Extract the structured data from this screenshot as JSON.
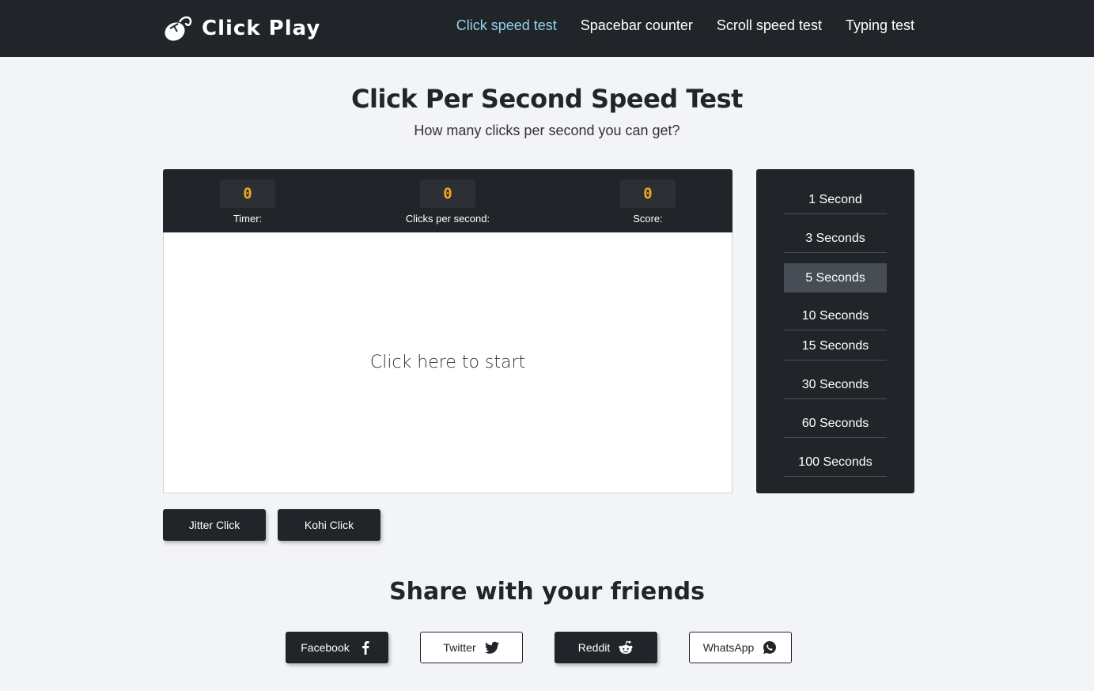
{
  "header": {
    "brand": "Click Play",
    "nav": [
      {
        "label": "Click speed test",
        "active": true
      },
      {
        "label": "Spacebar counter",
        "active": false
      },
      {
        "label": "Scroll speed test",
        "active": false
      },
      {
        "label": "Typing test",
        "active": false
      }
    ]
  },
  "main": {
    "title": "Click Per Second Speed Test",
    "subtitle": "How many clicks per second you can get?"
  },
  "stats": {
    "timer": {
      "value": "0",
      "label": "Timer:"
    },
    "cps": {
      "value": "0",
      "label": "Clicks per second:"
    },
    "score": {
      "value": "0",
      "label": "Score:"
    }
  },
  "click_area": {
    "label": "Click here to start"
  },
  "durations": [
    {
      "label": "1 Second",
      "active": false
    },
    {
      "label": "3 Seconds",
      "active": false
    },
    {
      "label": "5 Seconds",
      "active": true
    },
    {
      "label": "10 Seconds",
      "active": false
    },
    {
      "label": "15 Seconds",
      "active": false
    },
    {
      "label": "30 Seconds",
      "active": false
    },
    {
      "label": "60 Seconds",
      "active": false
    },
    {
      "label": "100 Seconds",
      "active": false
    }
  ],
  "modes": {
    "jitter": "Jitter Click",
    "kohi": "Kohi Click"
  },
  "share": {
    "title": "Share with your friends",
    "buttons": [
      {
        "label": "Facebook",
        "icon": "facebook-icon",
        "style": "dark"
      },
      {
        "label": "Twitter",
        "icon": "twitter-icon",
        "style": "light"
      },
      {
        "label": "Reddit",
        "icon": "reddit-icon",
        "style": "dark"
      },
      {
        "label": "WhatsApp",
        "icon": "whatsapp-icon",
        "style": "light"
      }
    ]
  },
  "colors": {
    "dark": "#212529",
    "accent_nav": "#8fd3e6",
    "stat_value": "#f5a623",
    "background": "#f3f4f8"
  }
}
